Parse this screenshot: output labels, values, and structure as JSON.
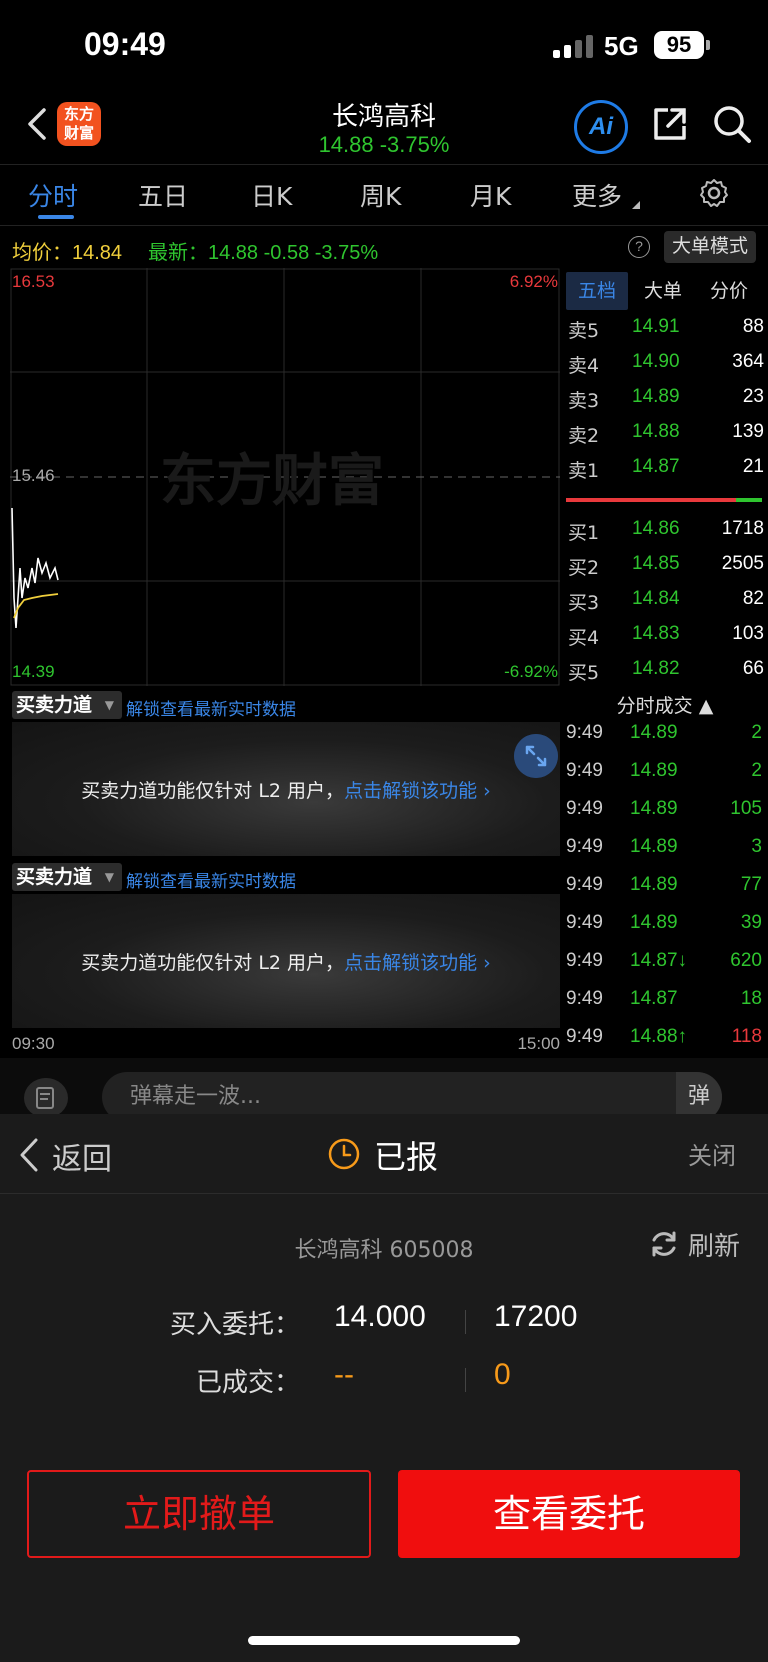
{
  "status": {
    "time": "09:49",
    "network": "5G",
    "battery": "95"
  },
  "nav": {
    "logo_text": "东方财富",
    "stock_name": "长鸿高科",
    "price_change": "14.88  -3.75%",
    "ai_label": "Ai"
  },
  "tabs": [
    "分时",
    "五日",
    "日K",
    "周K",
    "月K",
    "更多"
  ],
  "quote": {
    "avg_label": "均价：14.84",
    "latest_label": "最新：14.88  -0.58  -3.75%",
    "help": "?",
    "big_order_mode": "大单模式"
  },
  "chart_labels": {
    "high": "16.53",
    "high_pct": "6.92%",
    "mid": "15.46",
    "low": "14.39",
    "low_pct": "-6.92%",
    "watermark": "东方财富",
    "time_start": "09:30",
    "time_end": "15:00"
  },
  "colors": {
    "up": "#e8393c",
    "down": "#2fc52f",
    "avg": "#f0cf3c",
    "accent": "#3a86e6"
  },
  "book_tabs": [
    "五档",
    "大单",
    "分价"
  ],
  "asks": [
    {
      "label": "卖5",
      "price": "14.91",
      "vol": "88"
    },
    {
      "label": "卖4",
      "price": "14.90",
      "vol": "364"
    },
    {
      "label": "卖3",
      "price": "14.89",
      "vol": "23"
    },
    {
      "label": "卖2",
      "price": "14.88",
      "vol": "139"
    },
    {
      "label": "卖1",
      "price": "14.87",
      "vol": "21"
    }
  ],
  "bids": [
    {
      "label": "买1",
      "price": "14.86",
      "vol": "1718"
    },
    {
      "label": "买2",
      "price": "14.85",
      "vol": "2505"
    },
    {
      "label": "买3",
      "price": "14.84",
      "vol": "82"
    },
    {
      "label": "买4",
      "price": "14.83",
      "vol": "103"
    },
    {
      "label": "买5",
      "price": "14.82",
      "vol": "66"
    }
  ],
  "ticks_header": "分时成交 ▲",
  "ticks": [
    {
      "time": "9:49",
      "price": "14.89",
      "vol": "2"
    },
    {
      "time": "9:49",
      "price": "14.89",
      "vol": "2"
    },
    {
      "time": "9:49",
      "price": "14.89",
      "vol": "105"
    },
    {
      "time": "9:49",
      "price": "14.89",
      "vol": "3"
    },
    {
      "time": "9:49",
      "price": "14.89",
      "vol": "77"
    },
    {
      "time": "9:49",
      "price": "14.89",
      "vol": "39"
    },
    {
      "time": "9:49",
      "price": "14.87↓",
      "vol": "620"
    },
    {
      "time": "9:49",
      "price": "14.87",
      "vol": "18"
    },
    {
      "time": "9:49",
      "price": "14.88↑",
      "vol": "118"
    }
  ],
  "l2": {
    "dropdown": "买卖力道",
    "unlock_link": "解锁查看最新实时数据",
    "message": "买卖力道功能仅针对 L2 用户，",
    "message_link": "点击解锁该功能 ›"
  },
  "comment": {
    "placeholder": "弹幕走一波...",
    "toggle": "弹"
  },
  "sheet": {
    "back": "返回",
    "status": "已报",
    "close": "关闭",
    "stock": "长鸿高科 605008",
    "refresh": "刷新",
    "buy_label": "买入委托：",
    "buy_price": "14.000",
    "buy_qty": "17200",
    "filled_label": "已成交：",
    "filled_price": "--",
    "filled_qty": "0",
    "cancel_btn": "立即撤单",
    "view_btn": "查看委托"
  }
}
